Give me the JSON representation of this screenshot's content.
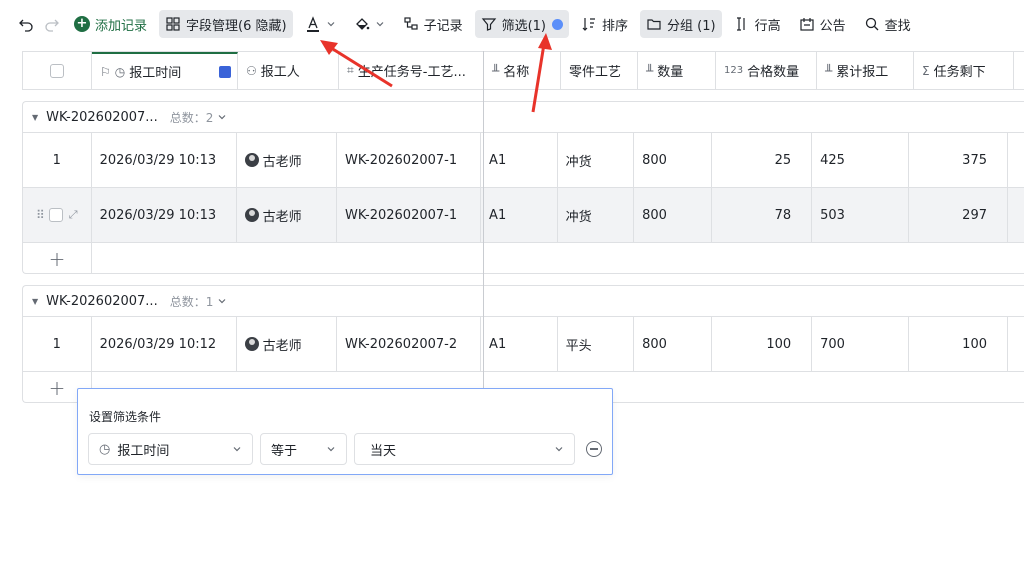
{
  "toolbar": {
    "add_record": "添加记录",
    "field_mgmt": "字段管理(6 隐藏)",
    "sub_record": "子记录",
    "filter": "筛选(1)",
    "sort": "排序",
    "group": "分组 (1)",
    "row_height": "行高",
    "announce": "公告",
    "search": "查找",
    "icons": [
      "undo-icon",
      "redo-icon",
      "plus-circle-icon",
      "grid-icon",
      "text-color-icon",
      "fill-color-icon",
      "sub-record-icon",
      "filter-icon",
      "sort-icon",
      "folder-icon",
      "row-height-icon",
      "announce-icon",
      "search-icon"
    ]
  },
  "columns": {
    "time": "报工时间",
    "user": "报工人",
    "task": "生产任务号-工艺...",
    "name": "名称",
    "process": "零件工艺",
    "qty": "数量",
    "pass_prefix": "123",
    "pass": "合格数量",
    "cumulative": "累计报工",
    "remaining": "任务剩下"
  },
  "groups": [
    {
      "name": "WK-202602007...",
      "count_label": "总数：2",
      "rows": [
        {
          "idx": "1",
          "time": "2026/03/29 10:13",
          "user": "古老师",
          "task": "WK-202602007-1",
          "name": "A1",
          "process": "冲货",
          "qty": "800",
          "pass": "25",
          "cum": "425",
          "rem": "375"
        },
        {
          "idx": "",
          "time": "2026/03/29 10:13",
          "user": "古老师",
          "task": "WK-202602007-1",
          "name": "A1",
          "process": "冲货",
          "qty": "800",
          "pass": "78",
          "cum": "503",
          "rem": "297"
        }
      ]
    },
    {
      "name": "WK-202602007...",
      "count_label": "总数：1",
      "rows": [
        {
          "idx": "1",
          "time": "2026/03/29 10:12",
          "user": "古老师",
          "task": "WK-202602007-2",
          "name": "A1",
          "process": "平头",
          "qty": "800",
          "pass": "100",
          "cum": "700",
          "rem": "100"
        }
      ]
    }
  ],
  "filter_popup": {
    "title": "设置筛选条件",
    "field": "报工时间",
    "operator": "等于",
    "value": "当天"
  },
  "colors": {
    "accent": "#2f6fed",
    "annotation": "#e8332a",
    "brand_green": "#1f6e43"
  }
}
